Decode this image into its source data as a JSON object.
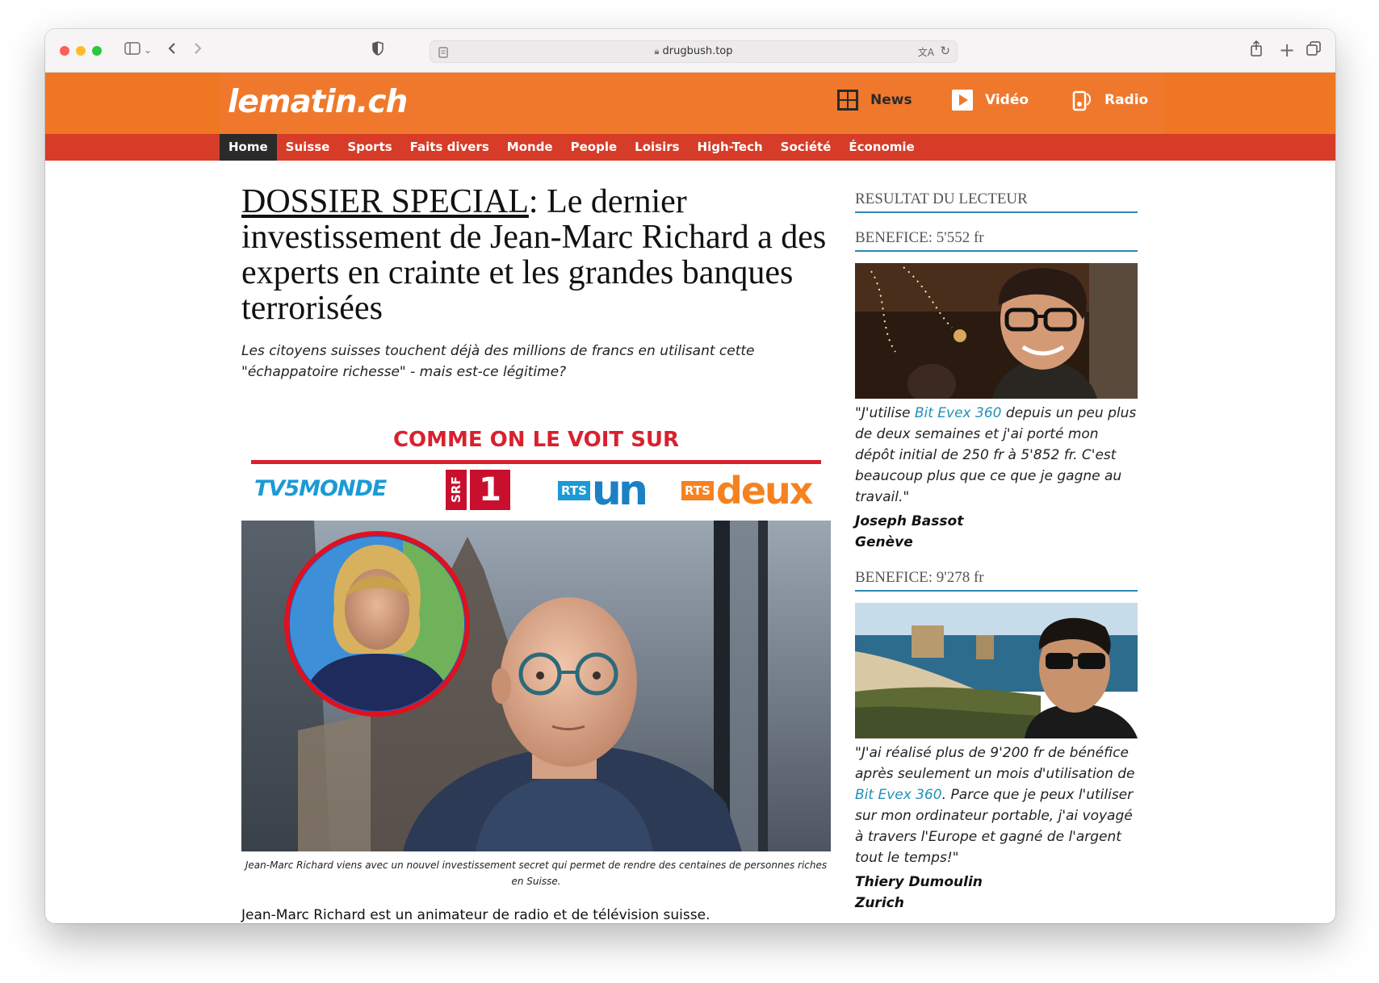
{
  "browser": {
    "url": "drugbush.top"
  },
  "site": {
    "logo": "lematin.ch",
    "top_nav": [
      "News",
      "Vidéo",
      "Radio"
    ],
    "nav": [
      "Home",
      "Suisse",
      "Sports",
      "Faits divers",
      "Monde",
      "People",
      "Loisirs",
      "High-Tech",
      "Société",
      "Économie"
    ],
    "active_nav": "Home"
  },
  "article": {
    "headline_prefix": "DOSSIER SPECIAL",
    "headline_rest": ": Le dernier investissement de Jean-Marc Richard a des experts en crainte et les grandes banques terrorisées",
    "subhead": "Les citoyens suisses touchent déjà des millions de francs en utilisant cette \"échappatoire richesse\" - mais est-ce légitime?",
    "seen_on": "COMME ON LE VOIT SUR",
    "seen_on_brands": [
      "TV5MONDE",
      "SRF",
      "1",
      "RTS",
      "un",
      "RTS",
      "deux"
    ],
    "caption": "Jean-Marc Richard viens avec un nouvel investissement secret qui permet de rendre des centaines de personnes riches en Suisse.",
    "body": "Jean-Marc Richard est un animateur de radio et de télévision suisse."
  },
  "sidebar": {
    "title": "RESULTAT DU LECTEUR",
    "testimonials": [
      {
        "heading": "BENEFICE: 5'552 fr",
        "quote_before": "\"J'utilise ",
        "link": "Bit Evex 360",
        "quote_after": " depuis un peu plus de deux semaines et j'ai porté mon dépôt initial de 250 fr à 5'852 fr. C'est beaucoup plus que ce que je gagne au travail.\"",
        "name": "Joseph Bassot",
        "city": "Genève"
      },
      {
        "heading": "BENEFICE: 9'278 fr",
        "quote_before": "\"J'ai réalisé plus de 9'200 fr de bénéfice après seulement un mois d'utilisation de ",
        "link": "Bit Evex 360",
        "quote_after": ". Parce que je peux l'utiliser sur mon ordinateur portable, j'ai voyagé à travers l'Europe et gagné de l'argent tout le temps!\"",
        "name": "Thiery Dumoulin",
        "city": "Zurich"
      }
    ]
  },
  "colors": {
    "orange": "#f0782c",
    "red_nav": "#d63c27",
    "link": "#1f90b8",
    "seen_red": "#d8212f"
  }
}
